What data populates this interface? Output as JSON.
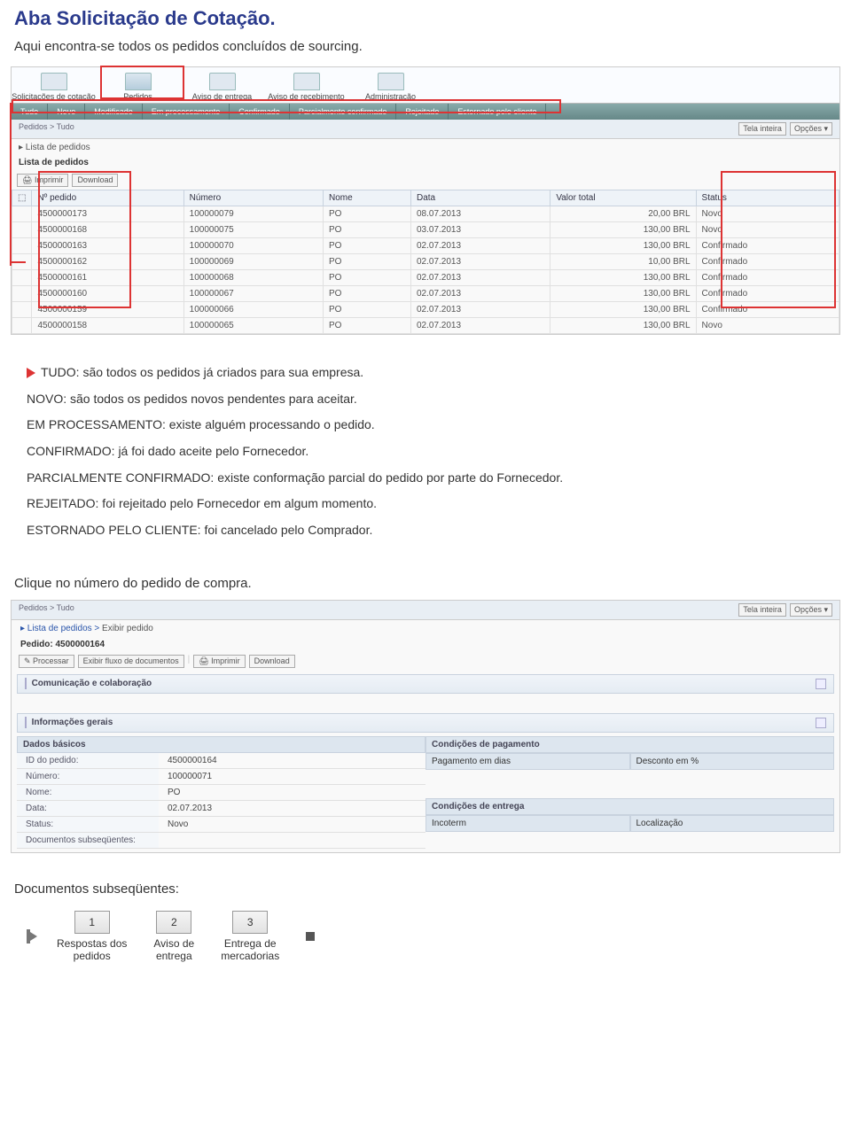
{
  "page": {
    "title": "Aba Solicitação de Cotação.",
    "intro": "Aqui encontra-se todos os pedidos concluídos de sourcing."
  },
  "screenshot1": {
    "top_tabs": [
      "Solicitações de cotação",
      "Pedidos",
      "Aviso de entrega",
      "Aviso de recebimento",
      "Administração"
    ],
    "filter_tabs": [
      "Tudo",
      "Novo",
      "Modificado",
      "Em processamento",
      "Confirmado",
      "Parcialmente confirmado",
      "Rejeitado",
      "Estornado pelo cliente"
    ],
    "breadcrumb": "Pedidos > Tudo",
    "tela_inteira": "Tela inteira",
    "opcoes": "Opções",
    "list_header": "▸ Lista de pedidos",
    "list_title": "Lista de pedidos",
    "btn_imprimir": "Imprimir",
    "btn_download": "Download",
    "columns": [
      "Nº pedido",
      "Número",
      "Nome",
      "Data",
      "Valor total",
      "Status"
    ],
    "rows": [
      {
        "pedido": "4500000173",
        "numero": "100000079",
        "nome": "PO",
        "data": "08.07.2013",
        "valor": "20,00 BRL",
        "status": "Novo"
      },
      {
        "pedido": "4500000168",
        "numero": "100000075",
        "nome": "PO",
        "data": "03.07.2013",
        "valor": "130,00 BRL",
        "status": "Novo"
      },
      {
        "pedido": "4500000163",
        "numero": "100000070",
        "nome": "PO",
        "data": "02.07.2013",
        "valor": "130,00 BRL",
        "status": "Confirmado"
      },
      {
        "pedido": "4500000162",
        "numero": "100000069",
        "nome": "PO",
        "data": "02.07.2013",
        "valor": "10,00 BRL",
        "status": "Confirmado"
      },
      {
        "pedido": "4500000161",
        "numero": "100000068",
        "nome": "PO",
        "data": "02.07.2013",
        "valor": "130,00 BRL",
        "status": "Confirmado"
      },
      {
        "pedido": "4500000160",
        "numero": "100000067",
        "nome": "PO",
        "data": "02.07.2013",
        "valor": "130,00 BRL",
        "status": "Confirmado"
      },
      {
        "pedido": "4500000159",
        "numero": "100000066",
        "nome": "PO",
        "data": "02.07.2013",
        "valor": "130,00 BRL",
        "status": "Confirmado"
      },
      {
        "pedido": "4500000158",
        "numero": "100000065",
        "nome": "PO",
        "data": "02.07.2013",
        "valor": "130,00 BRL",
        "status": "Novo"
      }
    ]
  },
  "definitions": {
    "tudo": "TUDO: são todos os pedidos já criados para sua empresa.",
    "novo": "NOVO: são todos os pedidos novos pendentes para aceitar.",
    "em_proc": "EM PROCESSAMENTO: existe alguém processando o pedido.",
    "confirmado": "CONFIRMADO: já foi dado aceite pelo Fornecedor.",
    "parcial": "PARCIALMENTE CONFIRMADO: existe conformação parcial do pedido por parte do Fornecedor.",
    "rejeitado": "REJEITADO: foi rejeitado pelo Fornecedor em algum momento.",
    "estornado": "ESTORNADO PELO CLIENTE: foi cancelado pelo Comprador."
  },
  "section2_text": "Clique no número do pedido de compra.",
  "screenshot2": {
    "breadcrumb": "Pedidos > Tudo",
    "tela_inteira": "Tela inteira",
    "opcoes": "Opções",
    "path_prefix": "▸ Lista de pedidos > ",
    "path_current": "Exibir pedido",
    "pedido_title": "Pedido: 4500000164",
    "btn_processar": "Processar",
    "btn_exibir_fluxo": "Exibir fluxo de documentos",
    "btn_imprimir": "Imprimir",
    "btn_download": "Download",
    "panel1": "Comunicação e colaboração",
    "panel2": "Informações gerais",
    "dados_basicos": "Dados básicos",
    "cond_pagamento": "Condições de pagamento",
    "pag_dias": "Pagamento em dias",
    "desconto": "Desconto em %",
    "cond_entrega": "Condições de entrega",
    "incoterm": "Incoterm",
    "localizacao": "Localização",
    "fields": [
      {
        "label": "ID do pedido:",
        "value": "4500000164"
      },
      {
        "label": "Número:",
        "value": "100000071"
      },
      {
        "label": "Nome:",
        "value": "PO"
      },
      {
        "label": "Data:",
        "value": "02.07.2013"
      },
      {
        "label": "Status:",
        "value": "Novo"
      },
      {
        "label": "Documentos subseqüentes:",
        "value": ""
      }
    ]
  },
  "doc_sub_title": "Documentos subseqüentes:",
  "flow": {
    "steps": [
      {
        "num": "1",
        "label": "Respostas dos\npedidos"
      },
      {
        "num": "2",
        "label": "Aviso de\nentrega"
      },
      {
        "num": "3",
        "label": "Entrega de\nmercadorias"
      }
    ]
  }
}
